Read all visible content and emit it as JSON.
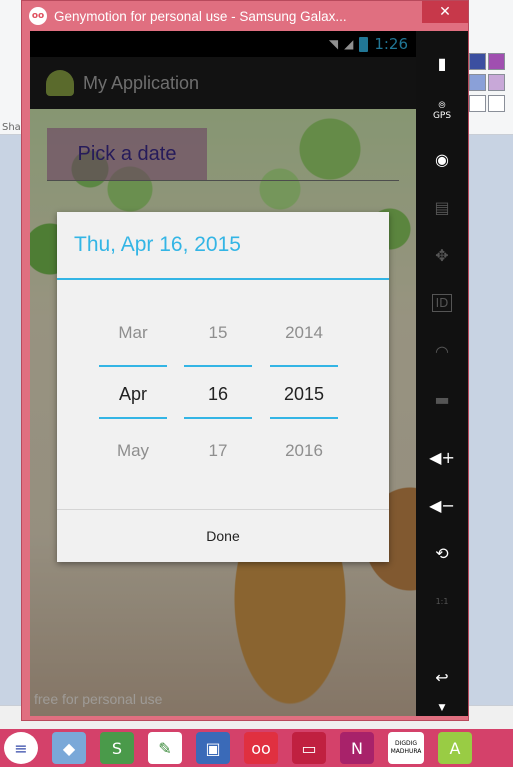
{
  "window": {
    "title": "Genymotion for personal use - Samsung Galax...",
    "close_icon": "close-icon"
  },
  "statusbar": {
    "time": "1:26"
  },
  "app": {
    "title": "My Application",
    "pick_button": "Pick a date",
    "watermark": "free for personal use"
  },
  "dialog": {
    "title": "Thu, Apr 16, 2015",
    "month": {
      "prev": "Mar",
      "current": "Apr",
      "next": "May"
    },
    "day": {
      "prev": "15",
      "current": "16",
      "next": "17"
    },
    "year": {
      "prev": "2014",
      "current": "2015",
      "next": "2016"
    },
    "done_label": "Done"
  },
  "toolbar": {
    "gps_label": "GPS",
    "id_label": "ID",
    "scale_label": "1:1"
  },
  "taskbar": {
    "badge_text": "DIGDIG MADHURA"
  },
  "background_app": {
    "ribbon_text": "Sha"
  },
  "colors": {
    "accent": "#33b5e5",
    "window_frame": "#e06f80",
    "close": "#c7384a",
    "taskbar": "#d4416a"
  }
}
